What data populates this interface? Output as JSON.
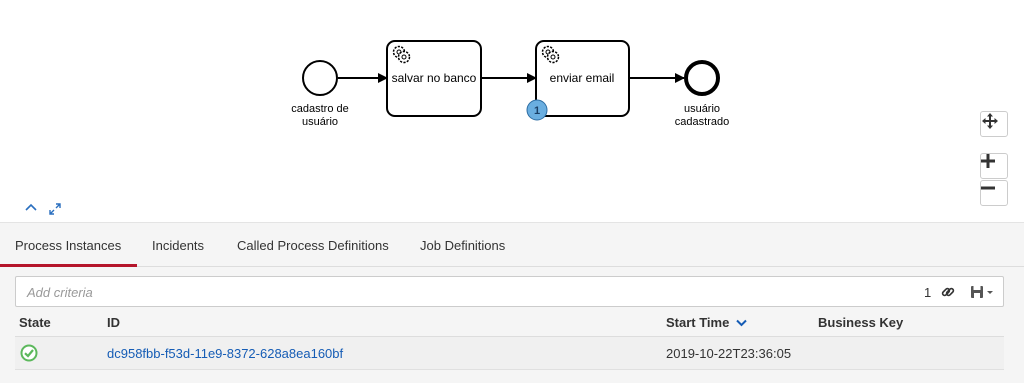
{
  "diagram": {
    "start_event_label_line1": "cadastro de",
    "start_event_label_line2": "usuário",
    "task1_label": "salvar no banco",
    "task2_label": "enviar email",
    "task2_instance_badge": "1",
    "end_event_label_line1": "usuário",
    "end_event_label_line2": "cadastrado"
  },
  "tabs": [
    {
      "label": "Process Instances",
      "active": true
    },
    {
      "label": "Incidents",
      "active": false
    },
    {
      "label": "Called Process Definitions",
      "active": false
    },
    {
      "label": "Job Definitions",
      "active": false
    }
  ],
  "search": {
    "placeholder": "Add criteria",
    "result_count": "1"
  },
  "table": {
    "columns": [
      "State",
      "ID",
      "Start Time",
      "Business Key"
    ],
    "sort_column": "Start Time",
    "rows": [
      {
        "state": "ok",
        "id": "dc958fbb-f53d-11e9-8372-628a8ea160bf",
        "start_time": "2019-10-22T23:36:05",
        "business_key": ""
      }
    ]
  },
  "colors": {
    "accent": "#b5152b",
    "link": "#155cb5",
    "success": "#5cb85c",
    "badge": "#6aaee0"
  }
}
